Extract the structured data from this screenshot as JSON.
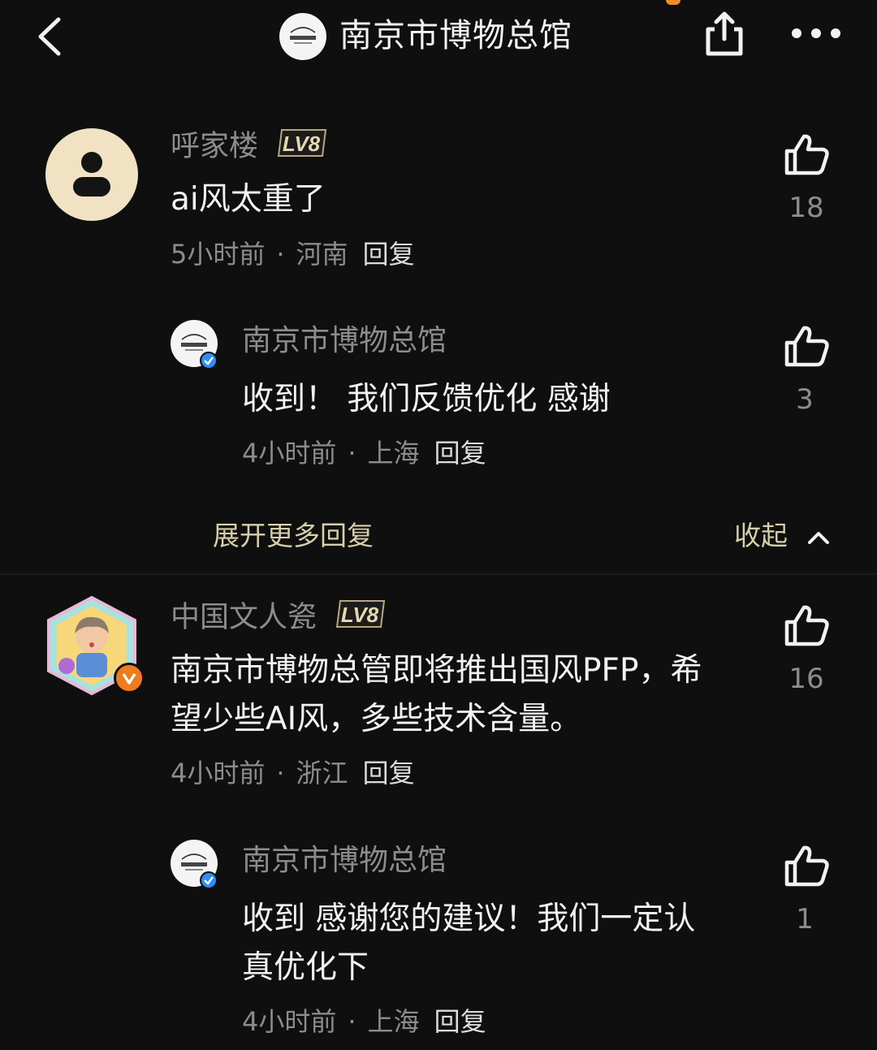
{
  "header": {
    "title": "南京市博物总馆",
    "avatar_label": "南京市博物总馆"
  },
  "comments": [
    {
      "user": "呼家楼",
      "level": "LV8",
      "text": "ai风太重了",
      "time": "5小时前",
      "location": "河南",
      "reply_label": "回复",
      "likes": "18",
      "replies": [
        {
          "user": "南京市博物总馆",
          "text": "收到！ 我们反馈优化 感谢",
          "time": "4小时前",
          "location": "上海",
          "reply_label": "回复",
          "likes": "3"
        }
      ]
    },
    {
      "user": "中国文人瓷",
      "level": "LV8",
      "text_line1": "南京市博物总管即将推出国风PFP，希",
      "text_line2": "望少些AI风，多些技术含量。",
      "time": "4小时前",
      "location": "浙江",
      "reply_label": "回复",
      "likes": "16",
      "replies": [
        {
          "user": "南京市博物总馆",
          "text_line1": "收到 感谢您的建议！我们一定认",
          "text_line2": "真优化下",
          "time": "4小时前",
          "location": "上海",
          "reply_label": "回复",
          "likes": "1"
        }
      ]
    }
  ],
  "thread_controls": {
    "expand_label": "展开更多回复",
    "collapse_label": "收起"
  },
  "colors": {
    "background": "#0f0f0f",
    "accent_gold": "#d6cfa9",
    "avatar_default_bg": "#f1e2c4",
    "verified_blue": "#2f8ef5",
    "verified_orange": "#f07a1e"
  },
  "icons": [
    "back-icon",
    "share-icon",
    "more-icon",
    "like-icon",
    "chevron-up-icon",
    "default-user-icon",
    "verified-icon"
  ]
}
